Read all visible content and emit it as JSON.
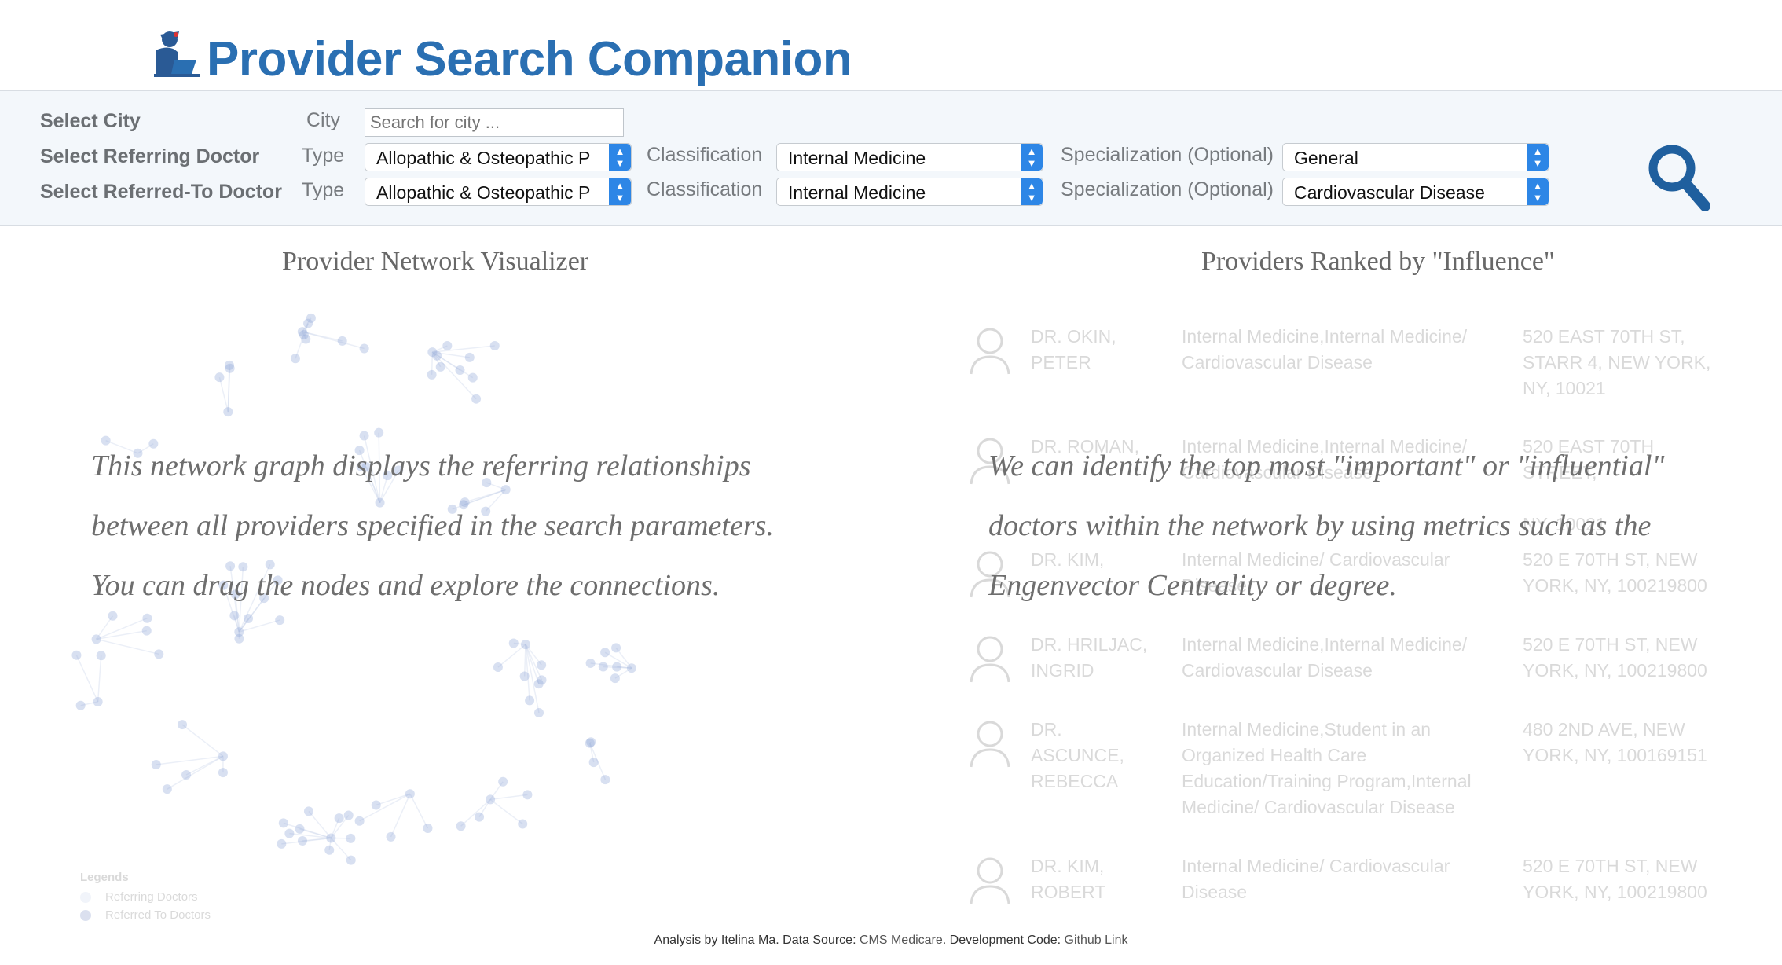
{
  "header": {
    "title": "Provider Search Companion"
  },
  "search": {
    "city_label": "Select City",
    "city_sub": "City",
    "city_placeholder": "Search for city ...",
    "referring_label": "Select Referring Doctor",
    "referred_label": "Select Referred-To Doctor",
    "type_label": "Type",
    "classification_label": "Classification",
    "specialization_label": "Specialization (Optional)",
    "referring": {
      "type": "Allopathic & Osteopathic P",
      "classification": "Internal Medicine",
      "specialization": "General"
    },
    "referred": {
      "type": "Allopathic & Osteopathic P",
      "classification": "Internal Medicine",
      "specialization": "Cardiovascular Disease"
    }
  },
  "network": {
    "title": "Provider Network Visualizer",
    "overlay": [
      "This network graph displays the referring relationships",
      "between all providers specified in the search parameters.",
      "You can drag the nodes and explore the connections."
    ],
    "legend": {
      "title": "Legends",
      "items": [
        "Referring Doctors",
        "Referred To Doctors"
      ]
    }
  },
  "ranking": {
    "title": "Providers Ranked by \"Influence\"",
    "overlay": [
      "We can identify the top most \"important\" or \"influential\"",
      "doctors within the network by using metrics such as the",
      "Engenvector Centrality or degree."
    ],
    "rows": [
      {
        "name": [
          "DR. OKIN,",
          "PETER"
        ],
        "spec": [
          "Internal Medicine,Internal Medicine/",
          "Cardiovascular Disease"
        ],
        "addr": [
          "520 EAST 70TH ST,",
          "STARR 4, NEW YORK,",
          "NY, 10021"
        ]
      },
      {
        "name": [
          "DR. ROMAN,",
          ""
        ],
        "spec": [
          "Internal Medicine,Internal Medicine/",
          "Cardiovascular Disease"
        ],
        "addr": [
          "520 EAST 70TH STREET,",
          "",
          "NY, 10021"
        ]
      },
      {
        "name": [
          "DR. KIM,",
          ""
        ],
        "spec": [
          "Internal Medicine/ Cardiovascular",
          "Disease"
        ],
        "addr": [
          "520 E 70TH ST, NEW",
          "YORK, NY, 100219800"
        ]
      },
      {
        "name": [
          "DR. HRILJAC,",
          "INGRID"
        ],
        "spec": [
          "Internal Medicine,Internal Medicine/",
          "Cardiovascular Disease"
        ],
        "addr": [
          "520 E 70TH ST, NEW",
          "YORK, NY, 100219800"
        ]
      },
      {
        "name": [
          "DR. ASCUNCE,",
          "REBECCA"
        ],
        "spec": [
          "Internal Medicine,Student in an",
          "Organized Health Care",
          "Education/Training Program,Internal",
          "Medicine/ Cardiovascular Disease"
        ],
        "addr": [
          "480 2ND AVE, NEW",
          "YORK, NY, 100169151"
        ]
      },
      {
        "name": [
          "DR. KIM,",
          "ROBERT"
        ],
        "spec": [
          "Internal Medicine/ Cardiovascular",
          "Disease"
        ],
        "addr": [
          "520 E 70TH ST, NEW",
          "YORK, NY, 100219800"
        ]
      }
    ]
  },
  "footer": {
    "prefix": "Analysis by Itelina Ma. Data Source: ",
    "source_link": "CMS Medicare",
    "middle": ". Development Code: ",
    "code_link": "Github Link"
  },
  "colors": {
    "brand": "#2a6fb2",
    "select_arrow": "#2d86e6",
    "node": "#8fa6d6"
  },
  "icons": {
    "logo": "doctor-laptop-icon",
    "search": "magnifier-icon",
    "avatar": "doctor-avatar-icon"
  }
}
